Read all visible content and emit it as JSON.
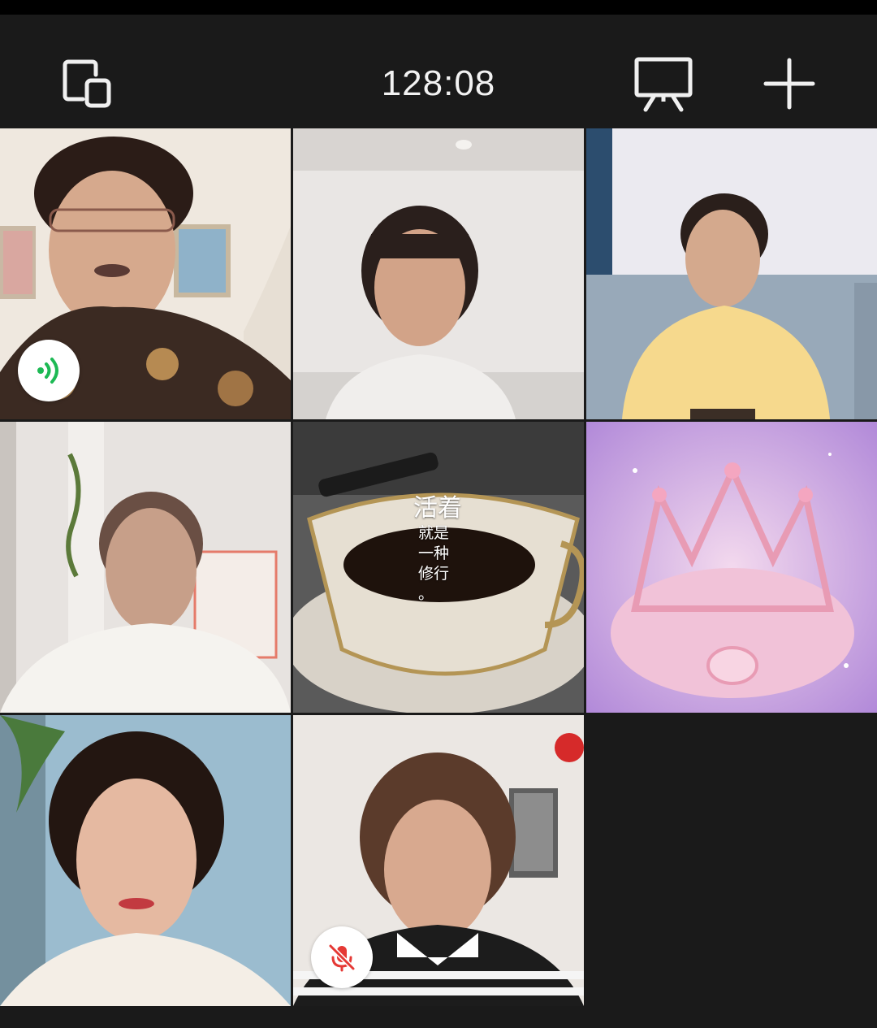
{
  "call": {
    "duration": "128:08",
    "minimize_label": "minimize",
    "share_screen_label": "share-screen",
    "add_member_label": "add-member"
  },
  "participants": [
    {
      "tile": "participant-1",
      "status": "speaking"
    },
    {
      "tile": "participant-2",
      "status": "video"
    },
    {
      "tile": "participant-3",
      "status": "video"
    },
    {
      "tile": "participant-4",
      "status": "video"
    },
    {
      "tile": "participant-5",
      "status": "avatar-image"
    },
    {
      "tile": "participant-6",
      "status": "avatar-image"
    },
    {
      "tile": "participant-7",
      "status": "video"
    },
    {
      "tile": "participant-8",
      "status": "muted"
    }
  ],
  "poem_image": {
    "line1": "活着",
    "line2": "就是",
    "line3": "一种",
    "line4": "修行",
    "line5": "。"
  },
  "colors": {
    "background": "#1a1a1a",
    "speaking": "#1db954",
    "muted": "#e53935",
    "text": "#f2f2f2"
  }
}
